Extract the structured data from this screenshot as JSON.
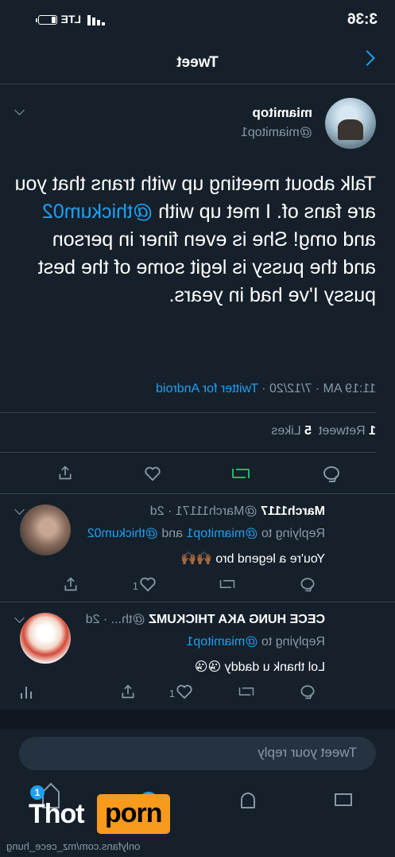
{
  "status_bar": {
    "time": "3:36",
    "network": "LTE"
  },
  "header": {
    "title": "Tweet"
  },
  "tweet": {
    "name": "miamitop",
    "handle": "@miamitop1",
    "text_before_mention": "Talk about meeting up with trans that you are fans of. I met up with ",
    "mention": "@thickum02",
    "text_after_mention": " and omg! She is even finer in person and the pussy is legit some of the best pussy I've had in years.",
    "time": "11:19 AM",
    "date": "7/12/20",
    "source": "Twitter for Android",
    "retweets": "1",
    "retweets_label": "Retweet",
    "likes": "5",
    "likes_label": "Likes"
  },
  "replies": [
    {
      "name": "March1117",
      "handle": "@March11171",
      "age": "2d",
      "replying_prefix": "Replying to",
      "replying_to": "@miamitop1",
      "replying_and": "and",
      "replying_to_2": "@thickum02",
      "text": "You're a legend bro 🙌🏾🙌🏾",
      "likes": "1"
    },
    {
      "name": "CECE HUNG AKA THICKUMZ",
      "handle": "@th...",
      "age": "2d",
      "replying_prefix": "Replying to",
      "replying_to": "@miamitop1",
      "text": "Lol thank u daddy 😘😘",
      "likes": "1"
    }
  ],
  "composer": {
    "placeholder": "Tweet your reply"
  },
  "tabbar": {
    "notifications_badge": "1"
  },
  "watermark": {
    "brand_left": "Thot",
    "brand_right": "porn",
    "url": "onlyfans.com/mz_cece_hung"
  },
  "colors": {
    "background": "#15202b",
    "accent": "#1da1f2",
    "muted": "#8899a6",
    "retweet_green": "#17bf63",
    "divider": "#38444d"
  },
  "icons": [
    "back-chevron-icon",
    "reply-icon",
    "retweet-icon",
    "like-icon",
    "share-icon",
    "analytics-icon",
    "home-icon",
    "search-icon",
    "notifications-icon",
    "messages-icon"
  ]
}
